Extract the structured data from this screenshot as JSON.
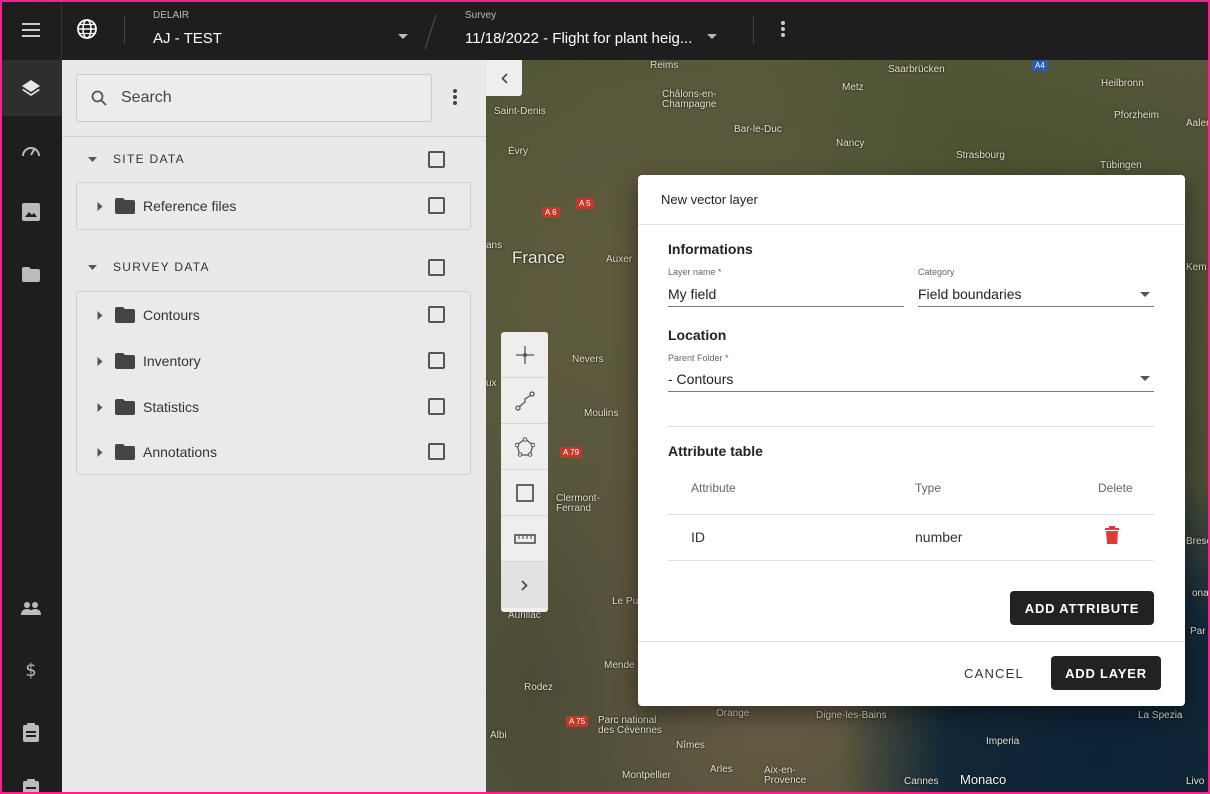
{
  "topbar": {
    "project_label": "DELAIR",
    "project_value": "AJ - TEST",
    "survey_label": "Survey",
    "survey_value": "11/18/2022 - Flight for plant heig..."
  },
  "rail": {
    "icons": [
      "menu-icon",
      "layers-icon",
      "dashboard-icon",
      "image-icon",
      "folder-icon",
      "users-icon",
      "dollar-icon",
      "clipboard-icon",
      "clipboard-icon-2"
    ]
  },
  "panel": {
    "search_placeholder": "Search",
    "site_section": "SITE DATA",
    "site_items": [
      {
        "label": "Reference files"
      }
    ],
    "survey_section": "SURVEY DATA",
    "survey_items": [
      {
        "label": "Contours"
      },
      {
        "label": "Inventory"
      },
      {
        "label": "Statistics"
      },
      {
        "label": "Annotations"
      }
    ]
  },
  "map": {
    "labels": {
      "reims": "Reims",
      "chalons": "Châlons-en-\nChampagne",
      "metz": "Metz",
      "saarbrucken": "Saarbrücken",
      "heilbronn": "Heilbronn",
      "pforzheim": "Pforzheim",
      "aalen": "Aalen",
      "saint_denis": "Saint-Denis",
      "bar_le_duc": "Bar-le-Duc",
      "nancy": "Nancy",
      "strasbourg": "Strasbourg",
      "tubingen": "Tübingen",
      "evry": "Évry",
      "france": "France",
      "auxerre": "Auxer",
      "nevers": "Nevers",
      "moulins": "Moulins",
      "clermont": "Clermont-\nFerrand",
      "aurillac": "Aurillac",
      "le_puy": "Le Pu",
      "mende": "Mende",
      "rodez": "Rodez",
      "albi": "Albi",
      "parc": "Parc national\ndes Cévennes",
      "nimes": "Nîmes",
      "montpellier": "Montpellier",
      "arles": "Arles",
      "aix": "Aix-en-\nProvence",
      "orange": "Orange",
      "digne": "Digne-les-Bains",
      "cannes": "Cannes",
      "monaco": "Monaco",
      "imperia": "Imperia",
      "la_spezia": "La Spezia",
      "ans": "ans",
      "ux": "ux",
      "kem": "Kem",
      "livo": "Livo",
      "par": "Par",
      "bresc": "Bresc",
      "ona": "ona"
    },
    "roads": {
      "a6": "A 6",
      "a5": "A 5",
      "a79": "A 79",
      "a75": "A 75",
      "a4": "A4"
    }
  },
  "dialog": {
    "title": "New vector layer",
    "informations_heading": "Informations",
    "layer_name_label": "Layer name *",
    "layer_name_value": "My field",
    "category_label": "Category",
    "category_value": "Field boundaries",
    "location_heading": "Location",
    "parent_folder_label": "Parent Folder *",
    "parent_folder_value": "- Contours",
    "attribute_heading": "Attribute table",
    "columns": {
      "attribute": "Attribute",
      "type": "Type",
      "delete": "Delete"
    },
    "rows": [
      {
        "attribute": "ID",
        "type": "number"
      }
    ],
    "add_attribute": "ADD ATTRIBUTE",
    "cancel": "CANCEL",
    "add_layer": "ADD LAYER",
    "delete_color": "#e53935"
  }
}
